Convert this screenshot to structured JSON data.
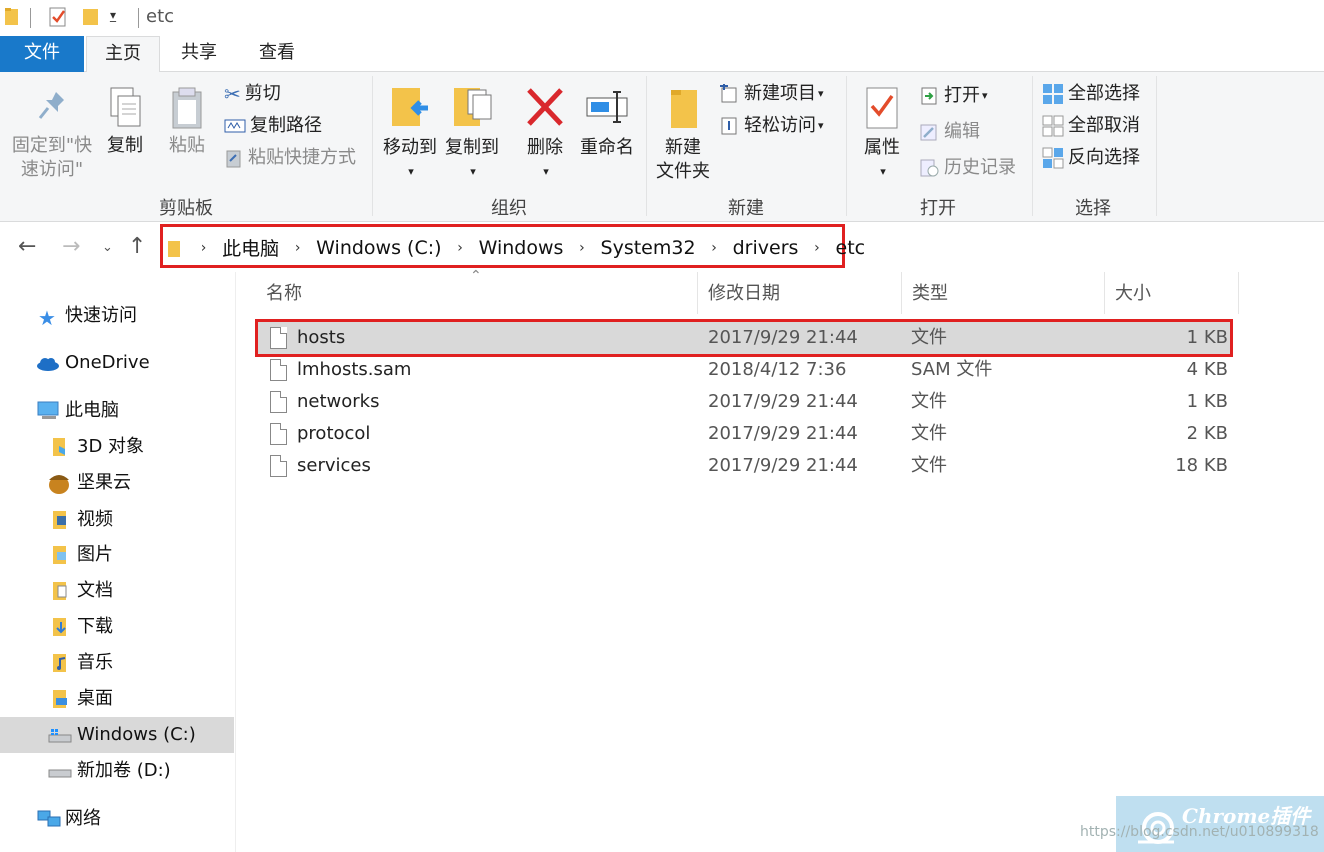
{
  "window": {
    "title": "etc"
  },
  "ribbon_tabs": [
    "文件",
    "主页",
    "共享",
    "查看"
  ],
  "ribbon": {
    "clipboard": {
      "label": "剪贴板",
      "pin_quick_access": "固定到\"快速访问\"",
      "copy": "复制",
      "paste": "粘贴",
      "cut": "剪切",
      "copy_path": "复制路径",
      "paste_shortcut": "粘贴快捷方式"
    },
    "organize": {
      "label": "组织",
      "move_to": "移动到",
      "copy_to": "复制到",
      "delete": "删除",
      "rename": "重命名"
    },
    "new": {
      "label": "新建",
      "new_folder": "新建\n文件夹",
      "new_item": "新建项目",
      "easy_access": "轻松访问"
    },
    "open": {
      "label": "打开",
      "properties": "属性",
      "open": "打开",
      "edit": "编辑",
      "history": "历史记录"
    },
    "select": {
      "label": "选择",
      "select_all": "全部选择",
      "select_none": "全部取消",
      "invert": "反向选择"
    }
  },
  "address": {
    "crumbs": [
      "此电脑",
      "Windows (C:)",
      "Windows",
      "System32",
      "drivers",
      "etc"
    ]
  },
  "sidebar": {
    "items": [
      {
        "label": "快速访问",
        "icon": "star-icon"
      },
      {
        "label": "OneDrive",
        "icon": "cloud-icon"
      },
      {
        "label": "此电脑",
        "icon": "computer-icon"
      },
      {
        "label": "3D 对象",
        "icon": "3d-objects-icon"
      },
      {
        "label": "坚果云",
        "icon": "nut-icon"
      },
      {
        "label": "视频",
        "icon": "video-folder-icon"
      },
      {
        "label": "图片",
        "icon": "pictures-folder-icon"
      },
      {
        "label": "文档",
        "icon": "documents-folder-icon"
      },
      {
        "label": "下载",
        "icon": "downloads-folder-icon"
      },
      {
        "label": "音乐",
        "icon": "music-folder-icon"
      },
      {
        "label": "桌面",
        "icon": "desktop-folder-icon"
      },
      {
        "label": "Windows (C:)",
        "icon": "drive-c-icon"
      },
      {
        "label": "新加卷 (D:)",
        "icon": "drive-d-icon"
      },
      {
        "label": "网络",
        "icon": "network-icon"
      }
    ]
  },
  "columns": {
    "name": "名称",
    "date": "修改日期",
    "type": "类型",
    "size": "大小"
  },
  "files": [
    {
      "name": "hosts",
      "date": "2017/9/29 21:44",
      "type": "文件",
      "size": "1 KB"
    },
    {
      "name": "lmhosts.sam",
      "date": "2018/4/12 7:36",
      "type": "SAM 文件",
      "size": "4 KB"
    },
    {
      "name": "networks",
      "date": "2017/9/29 21:44",
      "type": "文件",
      "size": "1 KB"
    },
    {
      "name": "protocol",
      "date": "2017/9/29 21:44",
      "type": "文件",
      "size": "2 KB"
    },
    {
      "name": "services",
      "date": "2017/9/29 21:44",
      "type": "文件",
      "size": "18 KB"
    }
  ],
  "watermark": {
    "brand": "Chrome插件",
    "url": "https://blog.csdn.net/u010899318"
  },
  "colors": {
    "accent": "#1979ca",
    "highlight": "#e02020",
    "selection": "#d9d9d9"
  }
}
